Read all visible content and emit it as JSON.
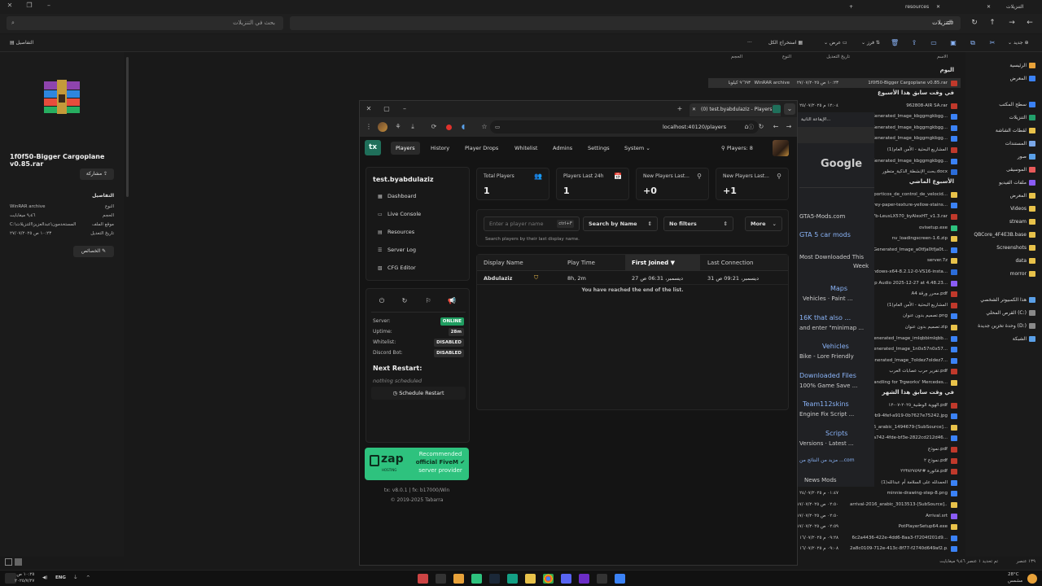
{
  "explorer": {
    "tab_downloads": "التنزيلات",
    "tab_resources": "resources",
    "search_placeholder": "بحث في التنزيلات",
    "path": "التنزيلات",
    "toolbar": {
      "new": "جديد",
      "sort": "فرز",
      "view": "عرض",
      "extract_all": "استخراج الكل",
      "details": "التفاصيل"
    },
    "details_pane": {
      "file_name": "1f0f50-Bigger Cargoplane v0.85.rar",
      "share": "مشاركة",
      "section": "التفاصيل",
      "rows": [
        {
          "k": "النوع",
          "v": "WinRAR archive"
        },
        {
          "k": "الحجم",
          "v": "٩٫٤٦ ميغابايت"
        },
        {
          "k": "موقع الملف",
          "v": "C:\\المستخدمون\\عبدالعزيز\\التنزيلات"
        },
        {
          "k": "تاريخ التعديل",
          "v": "١٠:٢٣ ص ٢٧/٠٧/٢٠٢٥"
        }
      ],
      "properties": "الخصائص"
    },
    "nav": [
      {
        "label": "الرئيسية",
        "color": "#e8a23a"
      },
      {
        "label": "المعرض",
        "color": "#3b82f6"
      },
      {
        "label": "سطح المكتب",
        "color": "#3b82f6"
      },
      {
        "label": "التنزيلات",
        "color": "#22a06b"
      },
      {
        "label": "لقطات الشاشة",
        "color": "#e8c24a"
      },
      {
        "label": "المستندات",
        "color": "#7aa7e8"
      },
      {
        "label": "صور",
        "color": "#5aa0e8"
      },
      {
        "label": "الموسيقى",
        "color": "#e85a5a"
      },
      {
        "label": "ملفات الفيديو",
        "color": "#8b5cf6"
      },
      {
        "label": "المعرض",
        "color": "#e8c24a"
      },
      {
        "label": "Videos",
        "color": "#e8c24a"
      },
      {
        "label": "stream",
        "color": "#e8c24a"
      },
      {
        "label": "QBCore_4F4E3B.base",
        "color": "#e8c24a"
      },
      {
        "label": "Screenshots",
        "color": "#e8c24a"
      },
      {
        "label": "data",
        "color": "#e8c24a"
      },
      {
        "label": "morror",
        "color": "#e8c24a"
      },
      {
        "label": "هذا الكمبيوتر الشخصي",
        "color": "#5aa0e8"
      },
      {
        "label": "القرص المحلي (C:)",
        "color": "#8a8a8a"
      },
      {
        "label": "وحدة تخزين جديدة (D:)",
        "color": "#8a8a8a"
      },
      {
        "label": "الشبكة",
        "color": "#5aa0e8"
      }
    ],
    "columns": {
      "name": "الاسم",
      "date": "تاريخ التعديل",
      "type": "النوع",
      "size": "الحجم"
    },
    "group_today": "اليوم",
    "group_week": "في وقت سابق هذا الأسبوع",
    "group_last_week": "الأسبوع الماضي",
    "group_month": "في وقت سابق هذا الشهر",
    "files_today": [
      {
        "name": "1f0f50-Bigger Cargoplane v0.85.rar",
        "date": "١٠:٢٣ ص ٢٧/٠٧/٢٠٢٥",
        "type": "WinRAR archive",
        "size": "٩٬٦٩٣ كيلوبا",
        "color": "#c0392b"
      }
    ],
    "files_week": [
      {
        "name": "962808-AIR SA.rar",
        "date": "١٢:٠٤ م ٢٥/٠٧/٢٠٢٥",
        "color": "#c0392b"
      },
      {
        "name": "Generated_Image_kbggmgkbgg...",
        "color": "#3b82f6"
      },
      {
        "name": "Generated_Image_kbggmgkbgg...",
        "color": "#3b82f6"
      },
      {
        "name": "Generated_Image_kbggmgkbgg...",
        "color": "#3b82f6"
      },
      {
        "name": "(1)المشاريع البحثية - الأمن العام",
        "color": "#c0392b"
      },
      {
        "name": "Generated_Image_kbggmgkbgg...",
        "color": "#3b82f6"
      },
      {
        "name": "بحث_الإنشطة_الذكية_متطور.docx",
        "color": "#2b6cd8"
      }
    ],
    "files_last_week": [
      {
        "name": "porticos_de_control_de_velocid...",
        "color": "#e8c24a"
      },
      {
        "name": "rey-paper-texture-yellow-stains...",
        "color": "#3b82f6"
      },
      {
        "name": "7b-LeusLX570_byAlexHT_v1.3.rar",
        "color": "#c0392b"
      },
      {
        "name": "ovisetup.exe",
        "color": "#2ec27e"
      },
      {
        "name": "nv_loadingscreen-1.6.zip",
        "color": "#e8c24a"
      },
      {
        "name": "Generated_Image_a0tfja0tfja0t...",
        "color": "#3b82f6"
      },
      {
        "name": "server.7z",
        "color": "#e8c24a"
      },
      {
        "name": "windows-x64-8.2.12-0-VS16-insta...",
        "color": "#2b6cd8"
      },
      {
        "name": "op Audio 2025-12-27 at 4.48.23...",
        "color": "#8b5cf6"
      },
      {
        "name": "A4 محرر ورقة.pdf",
        "color": "#c0392b"
      },
      {
        "name": "(1)المشاريع البحثية - الأمن العام",
        "color": "#c0392b"
      },
      {
        "name": "تصميم بدون عنوان.png",
        "color": "#3b82f6"
      },
      {
        "name": "تصميم بدون عنوان.zip",
        "color": "#e8c24a"
      },
      {
        "name": "Generated_Image_imlqbbimlqbb...",
        "color": "#3b82f6"
      },
      {
        "name": "Generated_Image_1n0x57n0x57...",
        "color": "#3b82f6"
      },
      {
        "name": "Generated_Image_7oldez7oldez7...",
        "color": "#3b82f6"
      },
      {
        "name": "تقرير حرب عصابات العرب.pdf",
        "color": "#c0392b"
      },
      {
        "name": "handling for Trgworks' Mercedes...",
        "color": "#e8c24a"
      }
    ],
    "files_month": [
      {
        "name": "الهوية الوطنية_٢٠٢٥-٠٧-١٢.pdf",
        "color": "#c0392b"
      },
      {
        "name": "c9b9-4fef-a919-0b7627e75242.jpg",
        "color": "#3b82f6"
      },
      {
        "name": "2016_arabic_1494679-[SubSource]...",
        "color": "#e8c24a"
      },
      {
        "name": "a742-4fde-bf3e-2822cd212d46...",
        "color": "#3b82f6"
      },
      {
        "name": "نموذج.pdf",
        "color": "#c0392b"
      },
      {
        "name": "نموذج ٢.pdf",
        "color": "#c0392b"
      },
      {
        "name": "فاتورة #٢٢٣٨٢٧٥٩٢.pdf",
        "color": "#c0392b"
      },
      {
        "name": "(1)الحمدلله على السلامة أم عبدالله",
        "color": "#3b82f6"
      },
      {
        "name": "minnie-drawing-step-8.png",
        "date": "٠١:٤٧ م ٢٤/٠٧/٢٠٢٥",
        "color": "#3b82f6"
      },
      {
        "name": "arrival-2016_arabic_3013513-[SubSource]...",
        "date": "٠٢:٥٠ ص ١٧/٠٧/٢٠٢٥",
        "color": "#e8c24a"
      },
      {
        "name": "Arrival.srt",
        "date": "٠٢:٥٠ ص ١٧/٠٧/٢٠٢٥",
        "color": "#8b5cf6"
      },
      {
        "name": "PotPlayerSetup64.exe",
        "date": "٠٢:٥٩ ص ١٧/٠٧/٢٠٢٥",
        "color": "#e8c24a"
      },
      {
        "name": "6c2a4436-422e-4dd6-8aa3-f7204f201d9...",
        "date": "٠٩:٢٨ م ١٦/٠٧/٢٠٢٥",
        "color": "#3b82f6"
      },
      {
        "name": "2a8c0109-712e-413c-8f77-f2740d649af2.p...",
        "date": "٠٩:٠٨ م ١٦/٠٧/٢٠٢٥",
        "color": "#3b82f6"
      }
    ],
    "status": {
      "count": "١٣٩ عنصر",
      "selected": "تم تحديد ١ عنصر ٩٫٤٦ ميغابايت"
    }
  },
  "chrome_mid": {
    "tab": "الإيقاعة الثانية...",
    "texts": [
      "GTA5-Mods.com",
      "GTA 5 car mods",
      "Most Downloaded This",
      "Week",
      "Maps",
      "Vehicles · Paint ...",
      "16K that also ...",
      "and enter \"minimap ...",
      "Vehicles",
      "Bike - Lore Friendly",
      "Downloaded Files",
      "100% Game Save ...",
      "Team112skins",
      "Engine Fix Script ...",
      "Scripts",
      "Versions · Latest ...",
      "مزيد من النتائج من ...com",
      "News Mods"
    ]
  },
  "browser": {
    "tab_title": "(0) test.byabdulaziz - Players",
    "url": "localhost:40120/players"
  },
  "tx": {
    "logo": "tx",
    "nav": [
      "Players",
      "History",
      "Player Drops",
      "Whitelist",
      "Admins",
      "Settings",
      "System"
    ],
    "players_label": "Players: 8",
    "server_name": "test.byabdulaziz",
    "menu": [
      {
        "icon": "dashboard-icon",
        "label": "Dashboard"
      },
      {
        "icon": "console-icon",
        "label": "Live Console"
      },
      {
        "icon": "resources-icon",
        "label": "Resources"
      },
      {
        "icon": "log-icon",
        "label": "Server Log"
      },
      {
        "icon": "cfg-icon",
        "label": "CFG Editor"
      }
    ],
    "status": [
      {
        "label": "Server:",
        "value": "ONLINE",
        "on": true
      },
      {
        "label": "Uptime:",
        "value": "28m",
        "on": false
      },
      {
        "label": "Whitelist:",
        "value": "DISABLED",
        "on": false
      },
      {
        "label": "Discord Bot:",
        "value": "DISABLED",
        "on": false
      }
    ],
    "next_restart_title": "Next Restart:",
    "next_restart_value": "nothing scheduled",
    "schedule_button": "Schedule Restart",
    "zap": {
      "line1": "Recommended",
      "line2": "official FiveM",
      "line3": "server provider",
      "brand": "zap",
      "sub": "HOSTING"
    },
    "version": "tx: v8.0.1 | fx: b17000/Win",
    "copyright": "© 2019-2025 Tabarra",
    "stats": [
      {
        "label": "Total Players",
        "value": "1"
      },
      {
        "label": "Players Last 24h",
        "value": "1"
      },
      {
        "label": "New Players Last...",
        "value": "+0"
      },
      {
        "label": "New Players Last...",
        "value": "+1"
      }
    ],
    "search_placeholder": "Enter a player name",
    "search_kbd": "ctrl+F",
    "search_by": "Search by Name",
    "filters": "No filters",
    "more": "More",
    "search_hint": "Search players by their last display name.",
    "table": {
      "headers": [
        "Display Name",
        "Play Time",
        "First Joined",
        "Last Connection"
      ],
      "rows": [
        {
          "name": "Abdulaziz",
          "play_time": "8h, 2m",
          "first_joined": "27 ديسمبر، 06:31 ص",
          "last_connection": "31 ديسمبر، 09:21 ص"
        }
      ],
      "end_text": "You have reached the end of the list."
    }
  },
  "taskbar": {
    "weather_temp": "28°C",
    "weather_desc": "مشمس",
    "lang": "ENG",
    "time": "١٠:٢٥ ص",
    "date": "٢٠٢٥/٧/٢٧"
  }
}
